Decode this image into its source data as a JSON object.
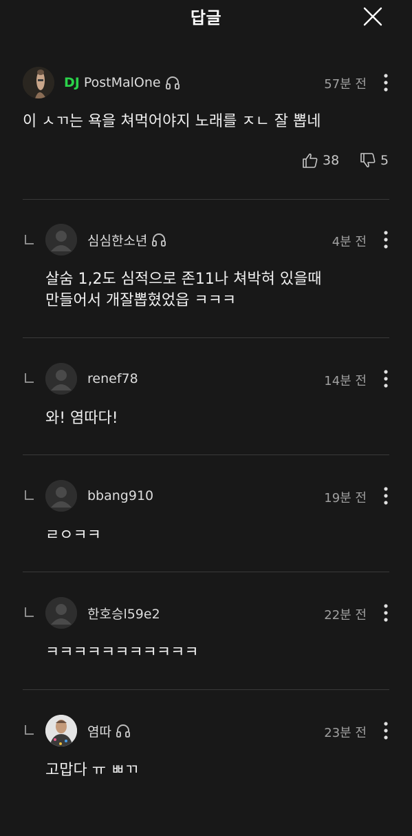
{
  "header": {
    "title": "답글"
  },
  "main_comment": {
    "badge": "DJ",
    "username": "PostMalOne",
    "time": "57분 전",
    "text": "이 ㅅㄲ는 욕을 쳐먹어야지 노래를 ㅈㄴ 잘 뽑네",
    "likes": "38",
    "dislikes": "5"
  },
  "replies": [
    {
      "username": "심심한소년",
      "time": "4분 전",
      "line1": "살숨 1,2도 심적으로 존11나 쳐박혀 있을때",
      "line2": "만들어서 개잘뽑혔었읍 ㅋㅋㅋ"
    },
    {
      "username": "renef78",
      "time": "14분 전",
      "line1": "와! 염따다!"
    },
    {
      "username": "bbang910",
      "time": "19분 전",
      "line1": "ㄹㅇㅋㅋ"
    },
    {
      "username": "한호승l59e2",
      "time": "22분 전",
      "line1": "ㅋㅋㅋㅋㅋㅋㅋㅋㅋㅋㅋ"
    },
    {
      "username": "염따",
      "time": "23분 전",
      "line1": "고맙다 ㅠ ㅃㄲ"
    }
  ],
  "colors": {
    "background": "#181818",
    "dj_badge": "#2bd24a",
    "divider": "#3a3a3a"
  }
}
